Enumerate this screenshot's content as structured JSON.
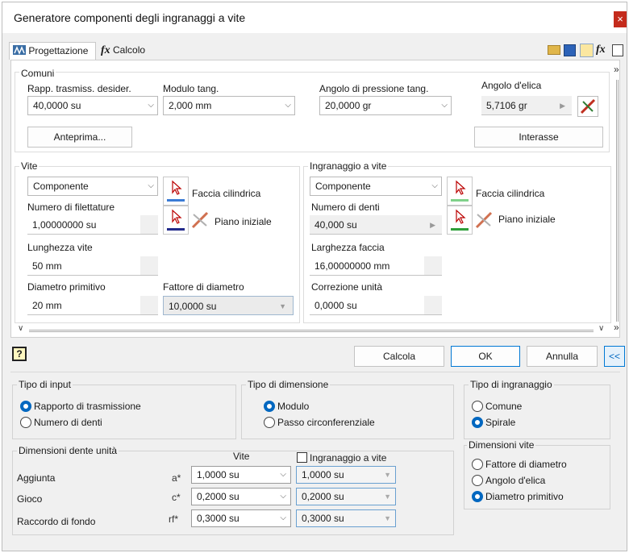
{
  "window": {
    "title": "Generatore componenti degli ingranaggi a vite",
    "close_glyph": "×"
  },
  "tabs": [
    {
      "label": "Progettazione"
    },
    {
      "label": "Calcolo"
    }
  ],
  "comuni": {
    "group_label": "Comuni",
    "ratio_label": "Rapp. trasmiss. desider.",
    "ratio_value": "40,0000 su",
    "module_label": "Modulo tang.",
    "module_value": "2,000 mm",
    "pressure_label": "Angolo di pressione tang.",
    "pressure_value": "20,0000 gr",
    "helix_label": "Angolo d'elica",
    "helix_value": "5,7106 gr",
    "preview_button": "Anteprima...",
    "center_button": "Interasse"
  },
  "vite": {
    "group_label": "Vite",
    "type_value": "Componente",
    "cyl_face_label": "Faccia cilindrica",
    "start_plane_label": "Piano iniziale",
    "threads_label": "Numero di filettature",
    "threads_value": "1,00000000 su",
    "length_label": "Lunghezza vite",
    "length_value": "50 mm",
    "pitch_diam_label": "Diametro primitivo",
    "pitch_diam_value": "20 mm",
    "diam_factor_label": "Fattore di diametro",
    "diam_factor_value": "10,0000 su"
  },
  "ingranaggio": {
    "group_label": "Ingranaggio a vite",
    "type_value": "Componente",
    "cyl_face_label": "Faccia cilindrica",
    "start_plane_label": "Piano iniziale",
    "teeth_label": "Numero di denti",
    "teeth_value": "40,000 su",
    "face_width_label": "Larghezza faccia",
    "face_width_value": "16,00000000 mm",
    "correction_label": "Correzione unità",
    "correction_value": "0,0000 su"
  },
  "actions": {
    "help_glyph": "?",
    "calc": "Calcola",
    "ok": "OK",
    "cancel": "Annulla",
    "collapse": "<<"
  },
  "input_type": {
    "label": "Tipo di input",
    "options": [
      "Rapporto di trasmissione",
      "Numero di denti"
    ],
    "selected": 0
  },
  "dimension_type": {
    "label": "Tipo di dimensione",
    "options": [
      "Modulo",
      "Passo circonferenziale"
    ],
    "selected": 0
  },
  "gear_type": {
    "label": "Tipo di ingranaggio",
    "options": [
      "Comune",
      "Spirale"
    ],
    "selected": 1
  },
  "tooth_dims": {
    "label": "Dimensioni dente unità",
    "col_vite": "Vite",
    "col_gear": "Ingranaggio a vite",
    "rows": [
      {
        "label": "Aggiunta",
        "sym": "a*",
        "vite": "1,0000 su",
        "gear": "1,0000 su"
      },
      {
        "label": "Gioco",
        "sym": "c*",
        "vite": "0,2000 su",
        "gear": "0,2000 su"
      },
      {
        "label": "Raccordo di fondo",
        "sym": "rf*",
        "vite": "0,3000 su",
        "gear": "0,3000 su"
      }
    ]
  },
  "worm_dims": {
    "label": "Dimensioni vite",
    "options": [
      "Fattore di diametro",
      "Angolo d'elica",
      "Diametro primitivo"
    ],
    "selected": 2
  },
  "colors": {
    "accent": "#0067c0",
    "close": "#c42b1c"
  }
}
